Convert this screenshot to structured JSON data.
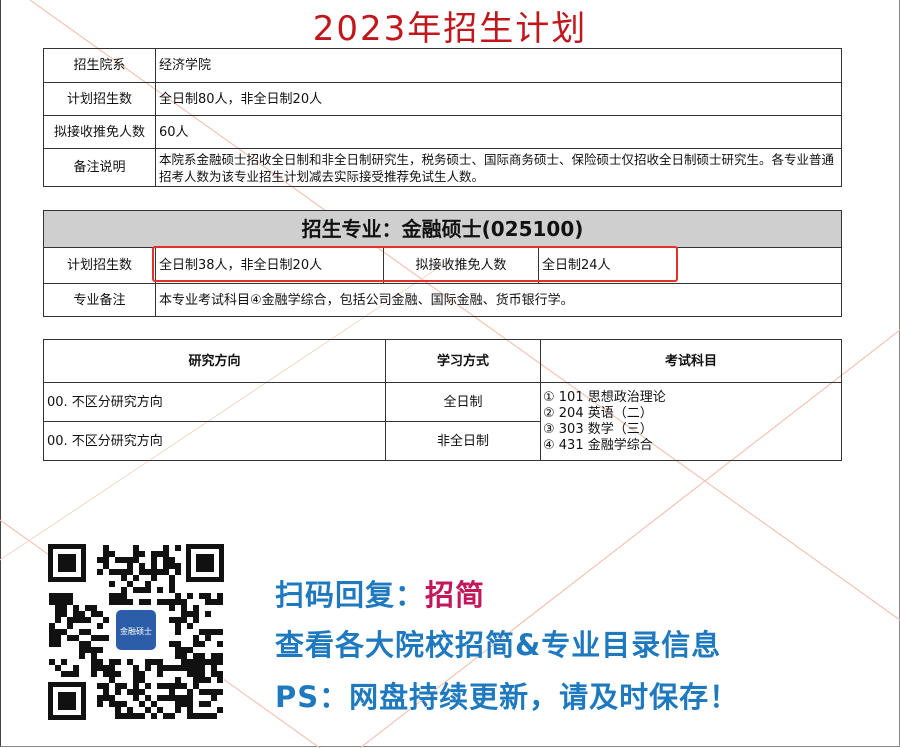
{
  "title": "2023年招生计划",
  "info": {
    "rows": [
      {
        "label": "招生院系",
        "value": "经济学院"
      },
      {
        "label": "计划招生数",
        "value": "全日制80人，非全日制20人"
      },
      {
        "label": "拟接收推免人数",
        "value": "60人"
      },
      {
        "label": "备注说明",
        "value": "本院系金融硕士招收全日制和非全日制研究生，税务硕士、国际商务硕士、保险硕士仅招收全日制硕士研究生。各专业普通招考人数为该专业招生计划减去实际接受推荐免试生人数。"
      }
    ]
  },
  "major": {
    "header": "招生专业：金融硕士(025100)",
    "plan_label": "计划招生数",
    "plan_value": "全日制38人，非全日制20人",
    "exempt_label": "拟接收推免人数",
    "exempt_value": "全日制24人",
    "note_label": "专业备注",
    "note_value": "本专业考试科目④金融学综合，包括公司金融、国际金融、货币银行学。"
  },
  "directions": {
    "headers": [
      "研究方向",
      "学习方式",
      "考试科目"
    ],
    "rows": [
      {
        "direction": "00. 不区分研究方向",
        "mode": "全日制"
      },
      {
        "direction": "00. 不区分研究方向",
        "mode": "非全日制"
      }
    ],
    "subjects": [
      "① 101 思想政治理论",
      "② 204 英语（二）",
      "③ 303 数学（三）",
      "④ 431 金融学综合"
    ]
  },
  "qr": {
    "badge": "金融硕士"
  },
  "promo": {
    "line1_prefix": "扫码回复：",
    "line1_accent": "招简",
    "line2": "查看各大院校招简&专业目录信息",
    "line3": "PS：网盘持续更新，请及时保存！"
  },
  "colors": {
    "title": "#c0161c",
    "highlight": "#e8302a",
    "promo": "#1f79bf",
    "accent": "#c2185b",
    "header_bg": "#cfcfcf"
  }
}
